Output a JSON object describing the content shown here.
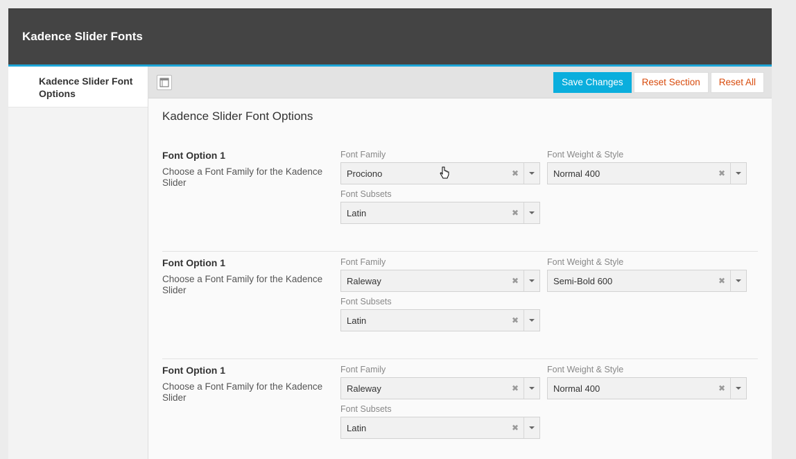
{
  "header": {
    "title": "Kadence Slider Fonts"
  },
  "sidebar": {
    "items": [
      {
        "label": "Kadence Slider Font Options"
      }
    ]
  },
  "toolbar": {
    "icon": "layout-toggle-icon",
    "save_label": "Save Changes",
    "reset_section_label": "Reset Section",
    "reset_all_label": "Reset All"
  },
  "main": {
    "section_title": "Kadence Slider Font Options",
    "options": [
      {
        "title": "Font Option 1",
        "description": "Choose a Font Family for the Kadence Slider",
        "family_label": "Font Family",
        "family_value": "Prociono",
        "weight_label": "Font Weight & Style",
        "weight_value": "Normal 400",
        "subsets_label": "Font Subsets",
        "subsets_value": "Latin"
      },
      {
        "title": "Font Option 1",
        "description": "Choose a Font Family for the Kadence Slider",
        "family_label": "Font Family",
        "family_value": "Raleway",
        "weight_label": "Font Weight & Style",
        "weight_value": "Semi-Bold 600",
        "subsets_label": "Font Subsets",
        "subsets_value": "Latin"
      },
      {
        "title": "Font Option 1",
        "description": "Choose a Font Family for the Kadence Slider",
        "family_label": "Font Family",
        "family_value": "Raleway",
        "weight_label": "Font Weight & Style",
        "weight_value": "Normal 400",
        "subsets_label": "Font Subsets",
        "subsets_value": "Latin"
      }
    ]
  },
  "colors": {
    "accent": "#0aaedd",
    "link": "#d84b0c",
    "header_bg": "#444444"
  }
}
